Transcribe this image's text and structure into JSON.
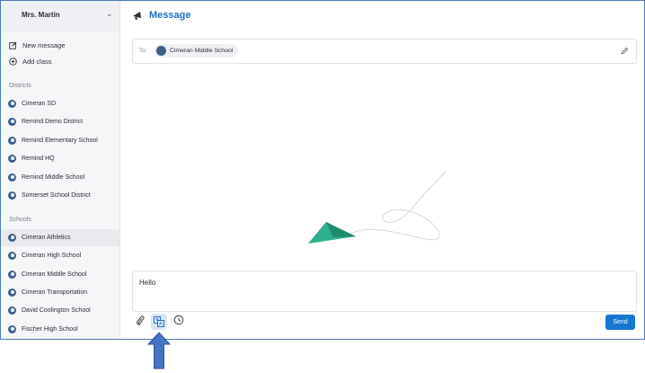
{
  "sidebar": {
    "user_name": "Mrs. Martin",
    "actions": [
      {
        "label": "New message",
        "icon": "compose-icon"
      },
      {
        "label": "Add class",
        "icon": "add-circle-icon"
      }
    ],
    "districts_heading": "Districts",
    "districts": [
      "Cimeran SD",
      "Remind Demo District",
      "Remind Elementary School",
      "Remind HQ",
      "Remind Middle School",
      "Somerset School District"
    ],
    "schools_heading": "Schools",
    "schools": [
      "Cimeran Athletics",
      "Cimeran High School",
      "Cimeran Middle School",
      "Cimeran Transportation",
      "David Coolington School",
      "Fischer High School"
    ],
    "active_school": "Cimeran Athletics"
  },
  "main": {
    "title": "Message",
    "to_label": "To:",
    "recipient": "Cimeran Middle School",
    "message_text": "Hello",
    "send_label": "Send"
  },
  "colors": {
    "accent": "#1f6fc8",
    "send_button": "#1677d2",
    "plane": "#2fae8f",
    "pointer_arrow": "#4472c4"
  }
}
